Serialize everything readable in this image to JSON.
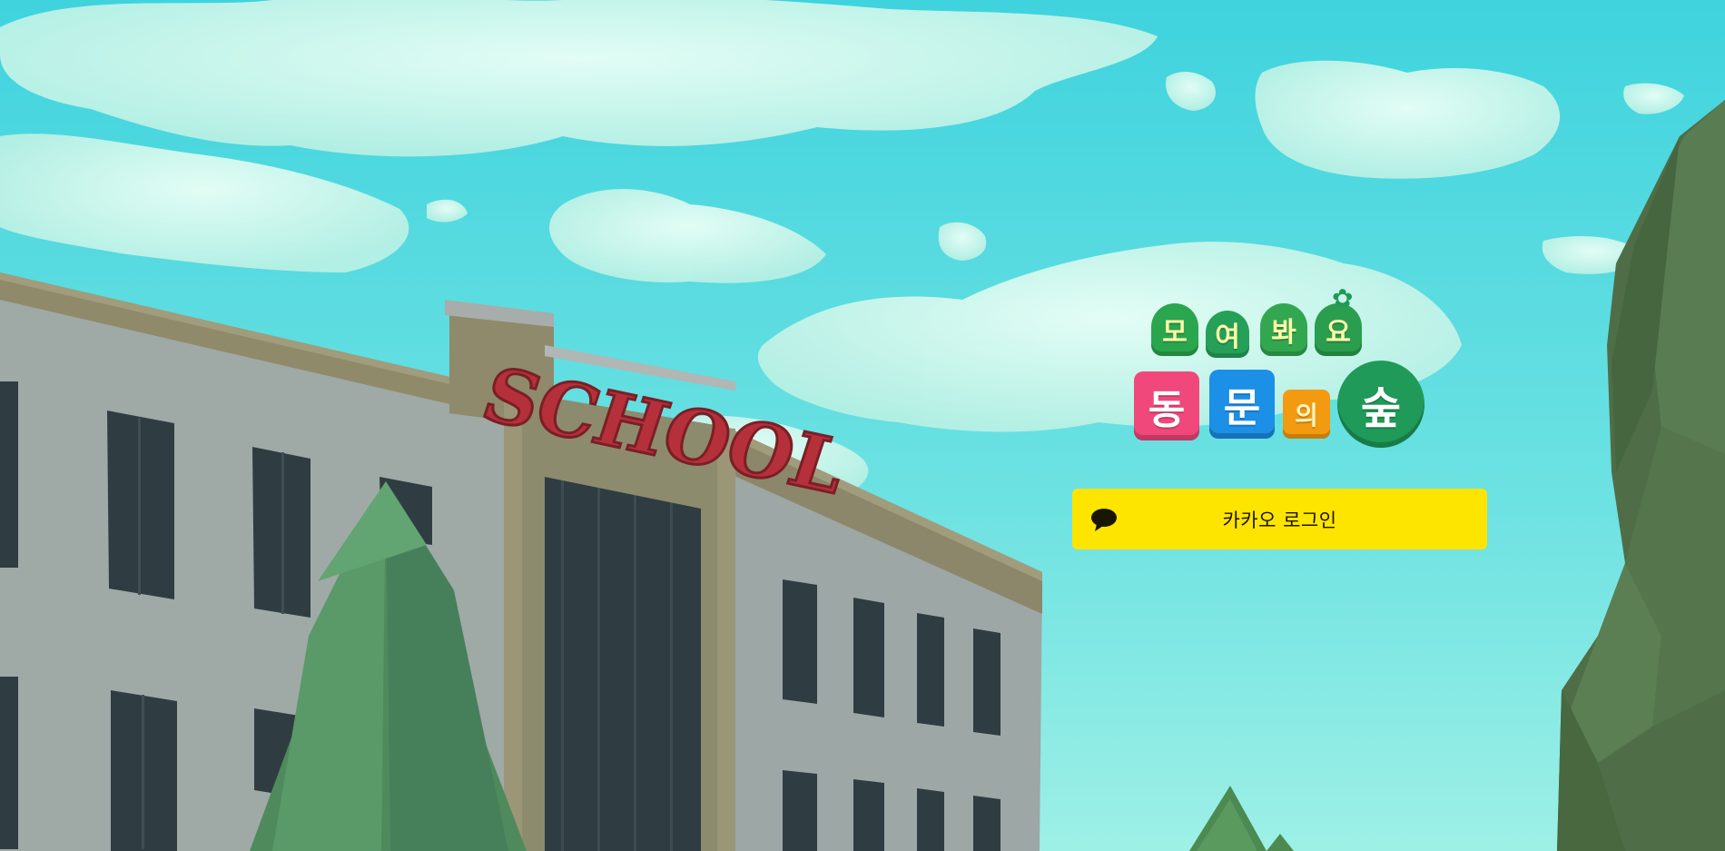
{
  "scene": {
    "sign_text": "SCHOOL"
  },
  "logo": {
    "line1": [
      "모",
      "여",
      "봐",
      "요"
    ],
    "line2": [
      "동",
      "문",
      "의",
      "숲"
    ],
    "colors": {
      "tile1": "#2fae4e",
      "tile2": "#1e9a55",
      "big1": "#f0487a",
      "big2": "#1c8fe6",
      "mid": "#f29a10",
      "tree": "#1f9a58"
    }
  },
  "login": {
    "label": "카카오 로그인",
    "icon": "speech-bubble-icon",
    "color": "#fee500"
  }
}
